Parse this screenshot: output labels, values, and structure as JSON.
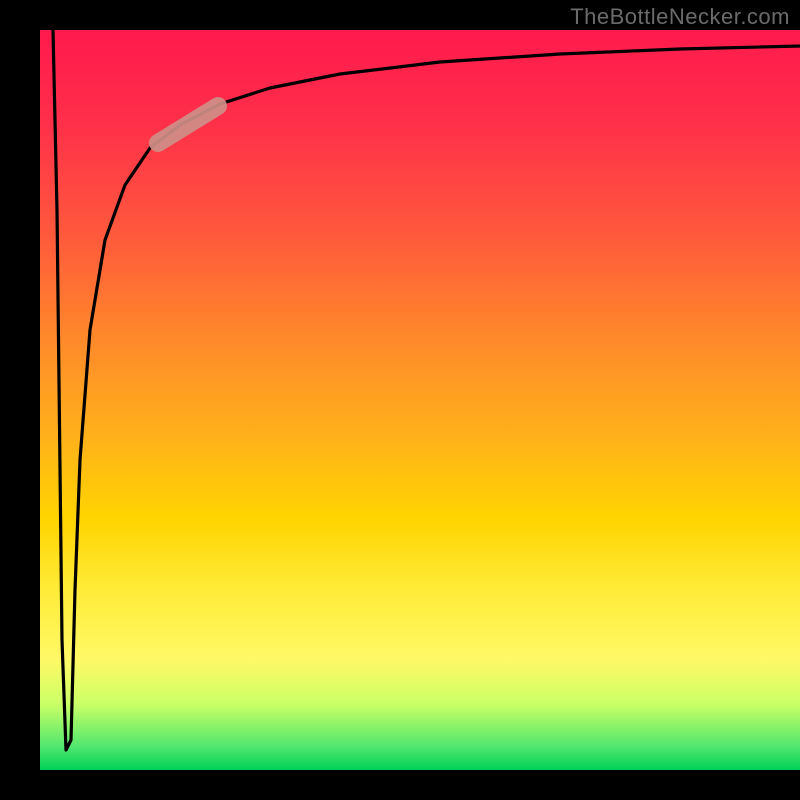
{
  "watermark": "TheBottleNecker.com",
  "chart_data": {
    "type": "line",
    "title": "",
    "xlabel": "",
    "ylabel": "",
    "xlim": [
      0,
      100
    ],
    "ylim": [
      0,
      100
    ],
    "x": [
      0,
      1,
      2,
      3,
      4,
      5,
      7,
      10,
      15,
      20,
      25,
      30,
      40,
      50,
      60,
      70,
      80,
      90,
      100
    ],
    "values": [
      100,
      45,
      5,
      0,
      22,
      45,
      62,
      75,
      84,
      88,
      90,
      91.5,
      93.5,
      94.8,
      95.8,
      96.5,
      97,
      97.3,
      97.5
    ],
    "highlight_segment": {
      "x_range": [
        16,
        24
      ],
      "y_range": [
        85,
        89
      ]
    },
    "background_gradient": {
      "direction": "vertical",
      "stops": [
        {
          "pos": 0.0,
          "color": "#ff1a4d"
        },
        {
          "pos": 0.45,
          "color": "#ff8a2a"
        },
        {
          "pos": 0.7,
          "color": "#ffec3a"
        },
        {
          "pos": 0.92,
          "color": "#ccff66"
        },
        {
          "pos": 1.0,
          "color": "#00d157"
        }
      ]
    }
  }
}
